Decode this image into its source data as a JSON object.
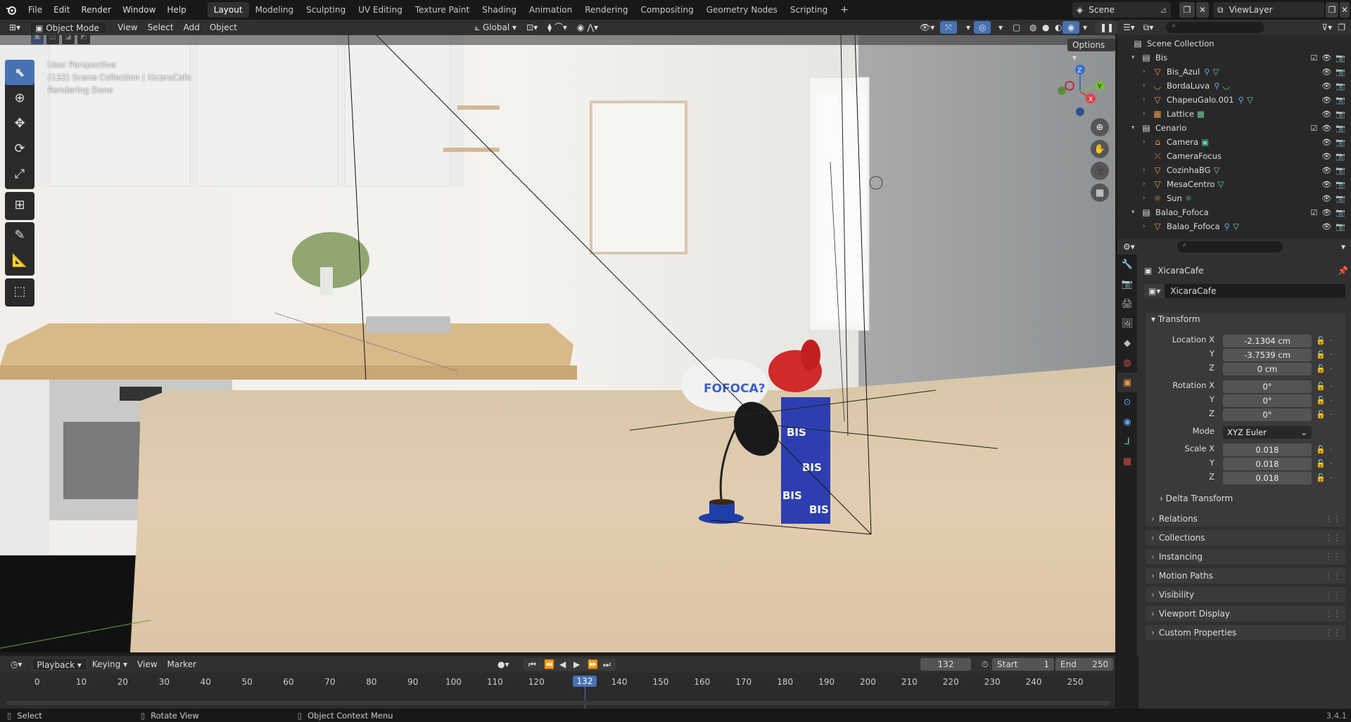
{
  "topbar": {
    "menus": [
      "File",
      "Edit",
      "Render",
      "Window",
      "Help"
    ],
    "workspaces": [
      "Layout",
      "Modeling",
      "Sculpting",
      "UV Editing",
      "Texture Paint",
      "Shading",
      "Animation",
      "Rendering",
      "Compositing",
      "Geometry Nodes",
      "Scripting"
    ],
    "active_workspace": "Layout",
    "add_tab": "+",
    "scene_name": "Scene",
    "view_layer": "ViewLayer"
  },
  "viewport_header": {
    "mode": "Object Mode",
    "menus": [
      "View",
      "Select",
      "Add",
      "Object"
    ],
    "orientation": "Global",
    "options": "Options"
  },
  "viewport": {
    "info_lines": [
      "User Perspective",
      "(132) Scene Collection | XicaraCafe",
      "Rendering Done"
    ],
    "props_text": [
      "FOFOCA?",
      "BIS",
      "BIS",
      "BIS",
      "BIS"
    ],
    "gizmo": {
      "z": "Z",
      "y": "Y",
      "x": "X"
    }
  },
  "outliner": {
    "title": "Scene Collection",
    "rows": [
      {
        "depth": 1,
        "kind": "collection",
        "label": "Bis",
        "expanded": true
      },
      {
        "depth": 2,
        "kind": "mesh",
        "label": "Bis_Azul"
      },
      {
        "depth": 2,
        "kind": "curve",
        "label": "BordaLuva"
      },
      {
        "depth": 2,
        "kind": "mesh",
        "label": "ChapeuGalo.001"
      },
      {
        "depth": 2,
        "kind": "lattice",
        "label": "Lattice"
      },
      {
        "depth": 1,
        "kind": "collection",
        "label": "Cenario",
        "expanded": true
      },
      {
        "depth": 2,
        "kind": "camera",
        "label": "Camera"
      },
      {
        "depth": 2,
        "kind": "empty",
        "label": "CameraFocus"
      },
      {
        "depth": 2,
        "kind": "mesh",
        "label": "CozinhaBG"
      },
      {
        "depth": 2,
        "kind": "mesh",
        "label": "MesaCentro"
      },
      {
        "depth": 2,
        "kind": "light",
        "label": "Sun"
      },
      {
        "depth": 1,
        "kind": "collection",
        "label": "Balao_Fofoca",
        "expanded": true
      },
      {
        "depth": 2,
        "kind": "mesh",
        "label": "Balao_Fofoca"
      }
    ]
  },
  "properties": {
    "object_name": "XicaraCafe",
    "datablock": "XicaraCafe",
    "transform_label": "Transform",
    "location_x_label": "Location X",
    "location_x": "-2.1304 cm",
    "location_y_label": "Y",
    "location_y": "-3.7539 cm",
    "location_z_label": "Z",
    "location_z": "0 cm",
    "rotation_x_label": "Rotation X",
    "rotation_x": "0°",
    "rotation_y_label": "Y",
    "rotation_y": "0°",
    "rotation_z_label": "Z",
    "rotation_z": "0°",
    "mode_label": "Mode",
    "mode_value": "XYZ Euler",
    "scale_x_label": "Scale X",
    "scale_x": "0.018",
    "scale_y_label": "Y",
    "scale_y": "0.018",
    "scale_z_label": "Z",
    "scale_z": "0.018",
    "delta_transform": "Delta Transform",
    "panels": [
      "Relations",
      "Collections",
      "Instancing",
      "Motion Paths",
      "Visibility",
      "Viewport Display",
      "Custom Properties"
    ]
  },
  "timeline": {
    "menus": [
      "Playback",
      "Keying",
      "View",
      "Marker"
    ],
    "current_frame": "132",
    "start_label": "Start",
    "start": "1",
    "end_label": "End",
    "end": "250",
    "ruler": [
      "0",
      "10",
      "20",
      "30",
      "40",
      "50",
      "60",
      "70",
      "80",
      "90",
      "100",
      "110",
      "120",
      "",
      "140",
      "150",
      "160",
      "170",
      "180",
      "190",
      "200",
      "210",
      "220",
      "230",
      "240",
      "250"
    ],
    "playhead_label": "132"
  },
  "status": {
    "select": "Select",
    "rotate": "Rotate View",
    "context": "Object Context Menu",
    "version": "3.4.1"
  }
}
